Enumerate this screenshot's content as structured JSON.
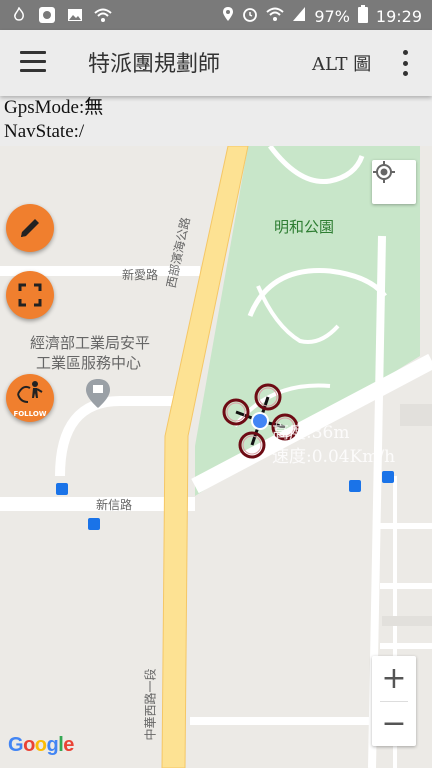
{
  "status_bar": {
    "icons_left": [
      "fire-icon",
      "app-badge-icon",
      "image-icon",
      "wifi-icon"
    ],
    "battery": "97%",
    "time": "19:29",
    "icons_right": [
      "location-icon",
      "alarm-icon",
      "wifi-icon",
      "signal-icon",
      "battery-icon"
    ]
  },
  "appbar": {
    "title": "特派團規劃師",
    "alt_label": "ALT 圖"
  },
  "info": {
    "gps_mode": "GpsMode:無",
    "nav_state": "NavState:/"
  },
  "map": {
    "labels": {
      "park": "明和公園",
      "road_xibu": "西部濱海公路",
      "road_xinai": "新愛路",
      "road_xinxin": "新信路",
      "road_zhonghua": "中華西路一段",
      "poi_line1": "經濟部工業局安平",
      "poi_line2": "工業區服務中心"
    },
    "drone_text": {
      "line1": "高度:36m",
      "line2": "速度:0.04Km/h"
    },
    "attribution": "Google",
    "zoom_in": "+",
    "zoom_out": "−"
  },
  "fabs": {
    "follow_label": "FOLLOW"
  },
  "colors": {
    "fab": "#f07f2e",
    "park": "#c8e6c9",
    "highway": "#fde293",
    "drone_ring": "#6e0b14",
    "location_dot": "#4285f4"
  }
}
